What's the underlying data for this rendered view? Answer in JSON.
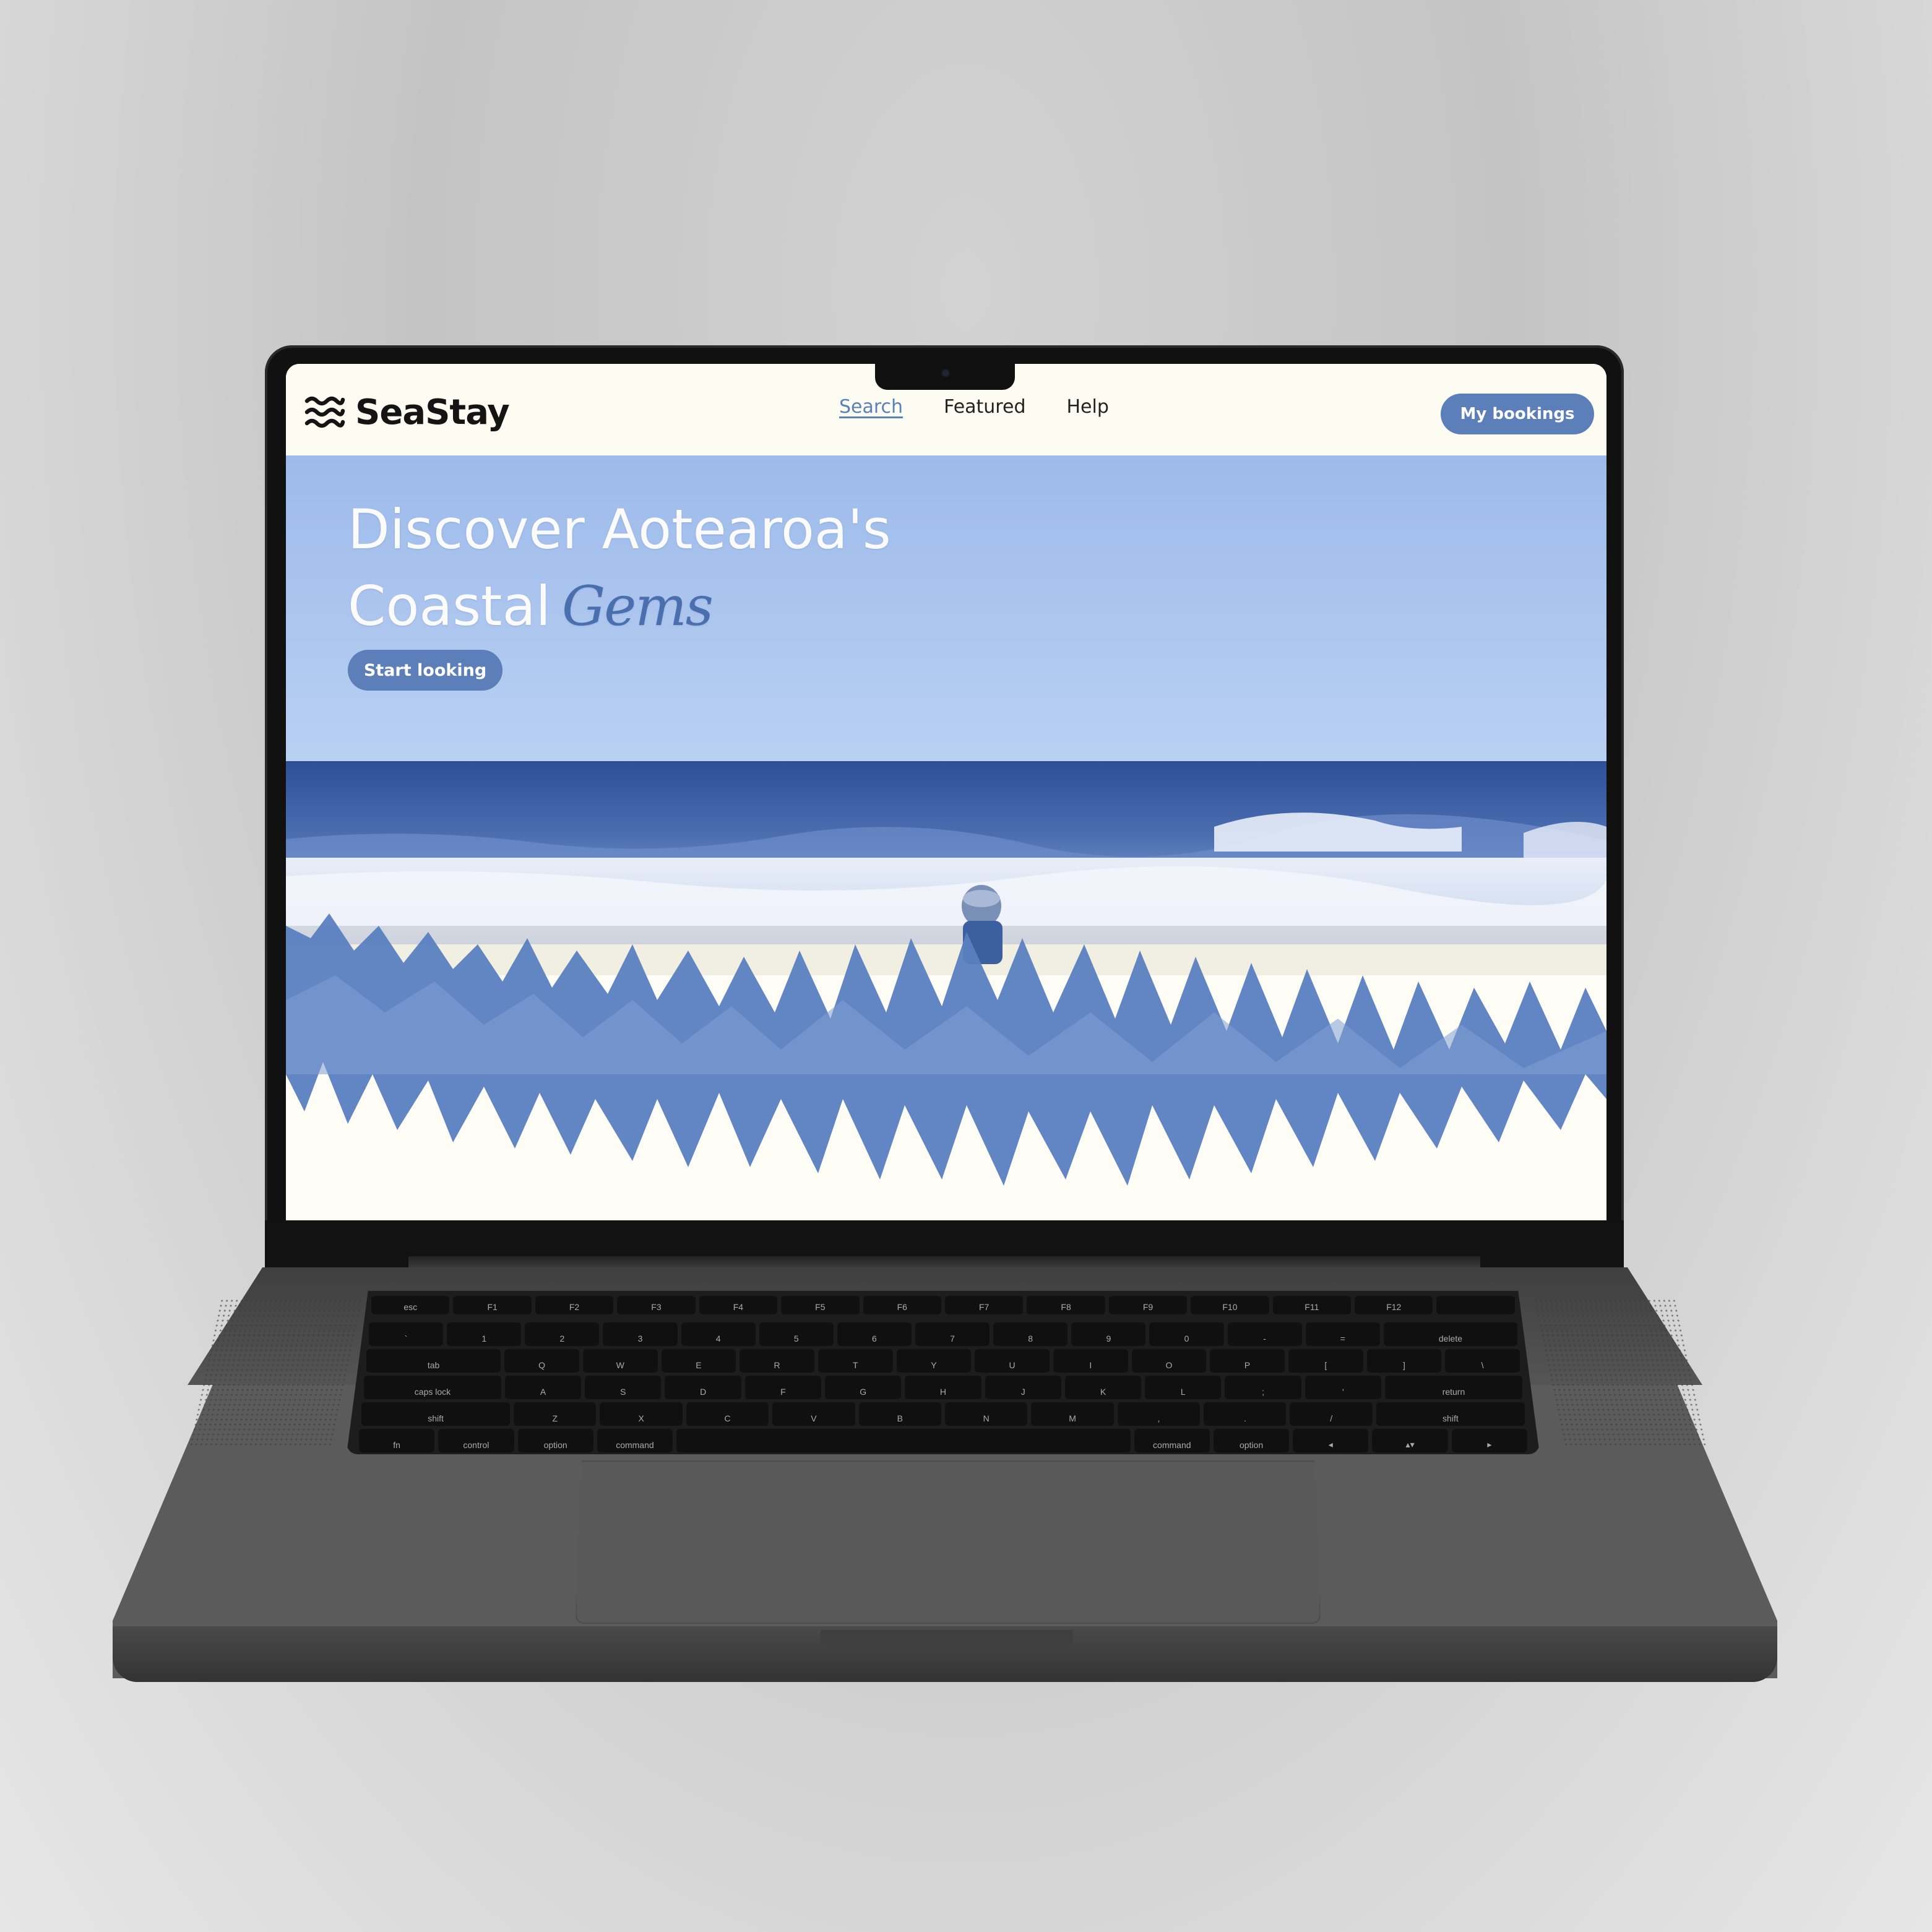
{
  "site": {
    "brand": "SeaStay",
    "logo_icon": "waves-icon",
    "nav": {
      "search": "Search",
      "featured": "Featured",
      "help": "Help"
    },
    "bookings_button": "My bookings"
  },
  "hero": {
    "title_line1": "Discover Aotearoa's",
    "title_line2": "Coastal",
    "title_script": "Gems",
    "cta": "Start looking"
  },
  "colors": {
    "accent": "#5c7fb9",
    "page_bg": "#fcfcf3",
    "sky": "#a9c3ec",
    "ocean": "#3f5fa3"
  },
  "keyboard": {
    "rows": [
      [
        "esc",
        "F1",
        "F2",
        "F3",
        "F4",
        "F5",
        "F6",
        "F7",
        "F8",
        "F9",
        "F10",
        "F11",
        "F12",
        ""
      ],
      [
        "`",
        "1",
        "2",
        "3",
        "4",
        "5",
        "6",
        "7",
        "8",
        "9",
        "0",
        "-",
        "=",
        "delete"
      ],
      [
        "tab",
        "Q",
        "W",
        "E",
        "R",
        "T",
        "Y",
        "U",
        "I",
        "O",
        "P",
        "[",
        "]",
        "\\"
      ],
      [
        "caps lock",
        "A",
        "S",
        "D",
        "F",
        "G",
        "H",
        "J",
        "K",
        "L",
        ";",
        "'",
        "return"
      ],
      [
        "shift",
        "Z",
        "X",
        "C",
        "V",
        "B",
        "N",
        "M",
        ",",
        ".",
        "/",
        "shift"
      ],
      [
        "fn",
        "control",
        "option",
        "command",
        "",
        "command",
        "option",
        "◂",
        "▴▾",
        "▸"
      ]
    ]
  }
}
